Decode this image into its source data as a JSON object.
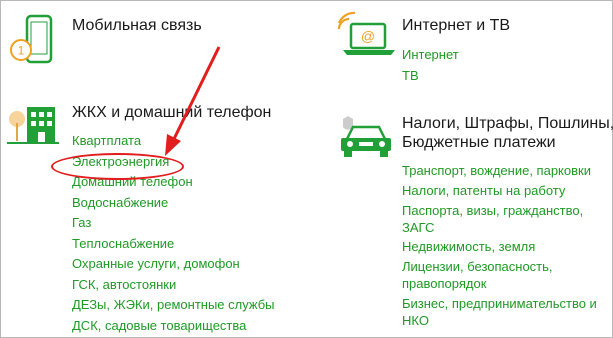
{
  "colors": {
    "accent": "#1f9a25",
    "icon_green": "#21a038",
    "icon_orange": "#f0a122",
    "annotation_red": "#e11d1d"
  },
  "left": {
    "mobile": {
      "title": "Мобильная связь",
      "icon": "phone-icon",
      "badge": "1"
    },
    "housing": {
      "title": "ЖКХ и домашний телефон",
      "icon": "building-icon",
      "items": [
        "Квартплата",
        "Электроэнергия",
        "Домашний телефон",
        "Водоснабжение",
        "Газ",
        "Теплоснабжение",
        "Охранные услуги, домофон",
        "ГСК, автостоянки",
        "ДЕЗы, ЖЭКи, ремонтные службы",
        "ДСК, садовые товарищества"
      ]
    }
  },
  "right": {
    "internet": {
      "title": "Интернет и ТВ",
      "icon": "laptop-wifi-icon",
      "items": [
        "Интернет",
        "ТВ"
      ]
    },
    "taxes": {
      "title_line1": "Налоги, Штрафы, Пошлины,",
      "title_line2": "Бюджетные платежи",
      "icon": "car-icon",
      "items": [
        "Транспорт, вождение, парковки",
        "Налоги, патенты на работу",
        "Паспорта, визы, гражданство, ЗАГС",
        "Недвижимость, земля",
        "Лицензии, безопасность, правопорядок",
        "Бизнес, предпринимательство и НКО"
      ]
    }
  },
  "annotation": {
    "type": "red-arrow-and-ellipse",
    "highlighted_item": "Электроэнергия"
  }
}
